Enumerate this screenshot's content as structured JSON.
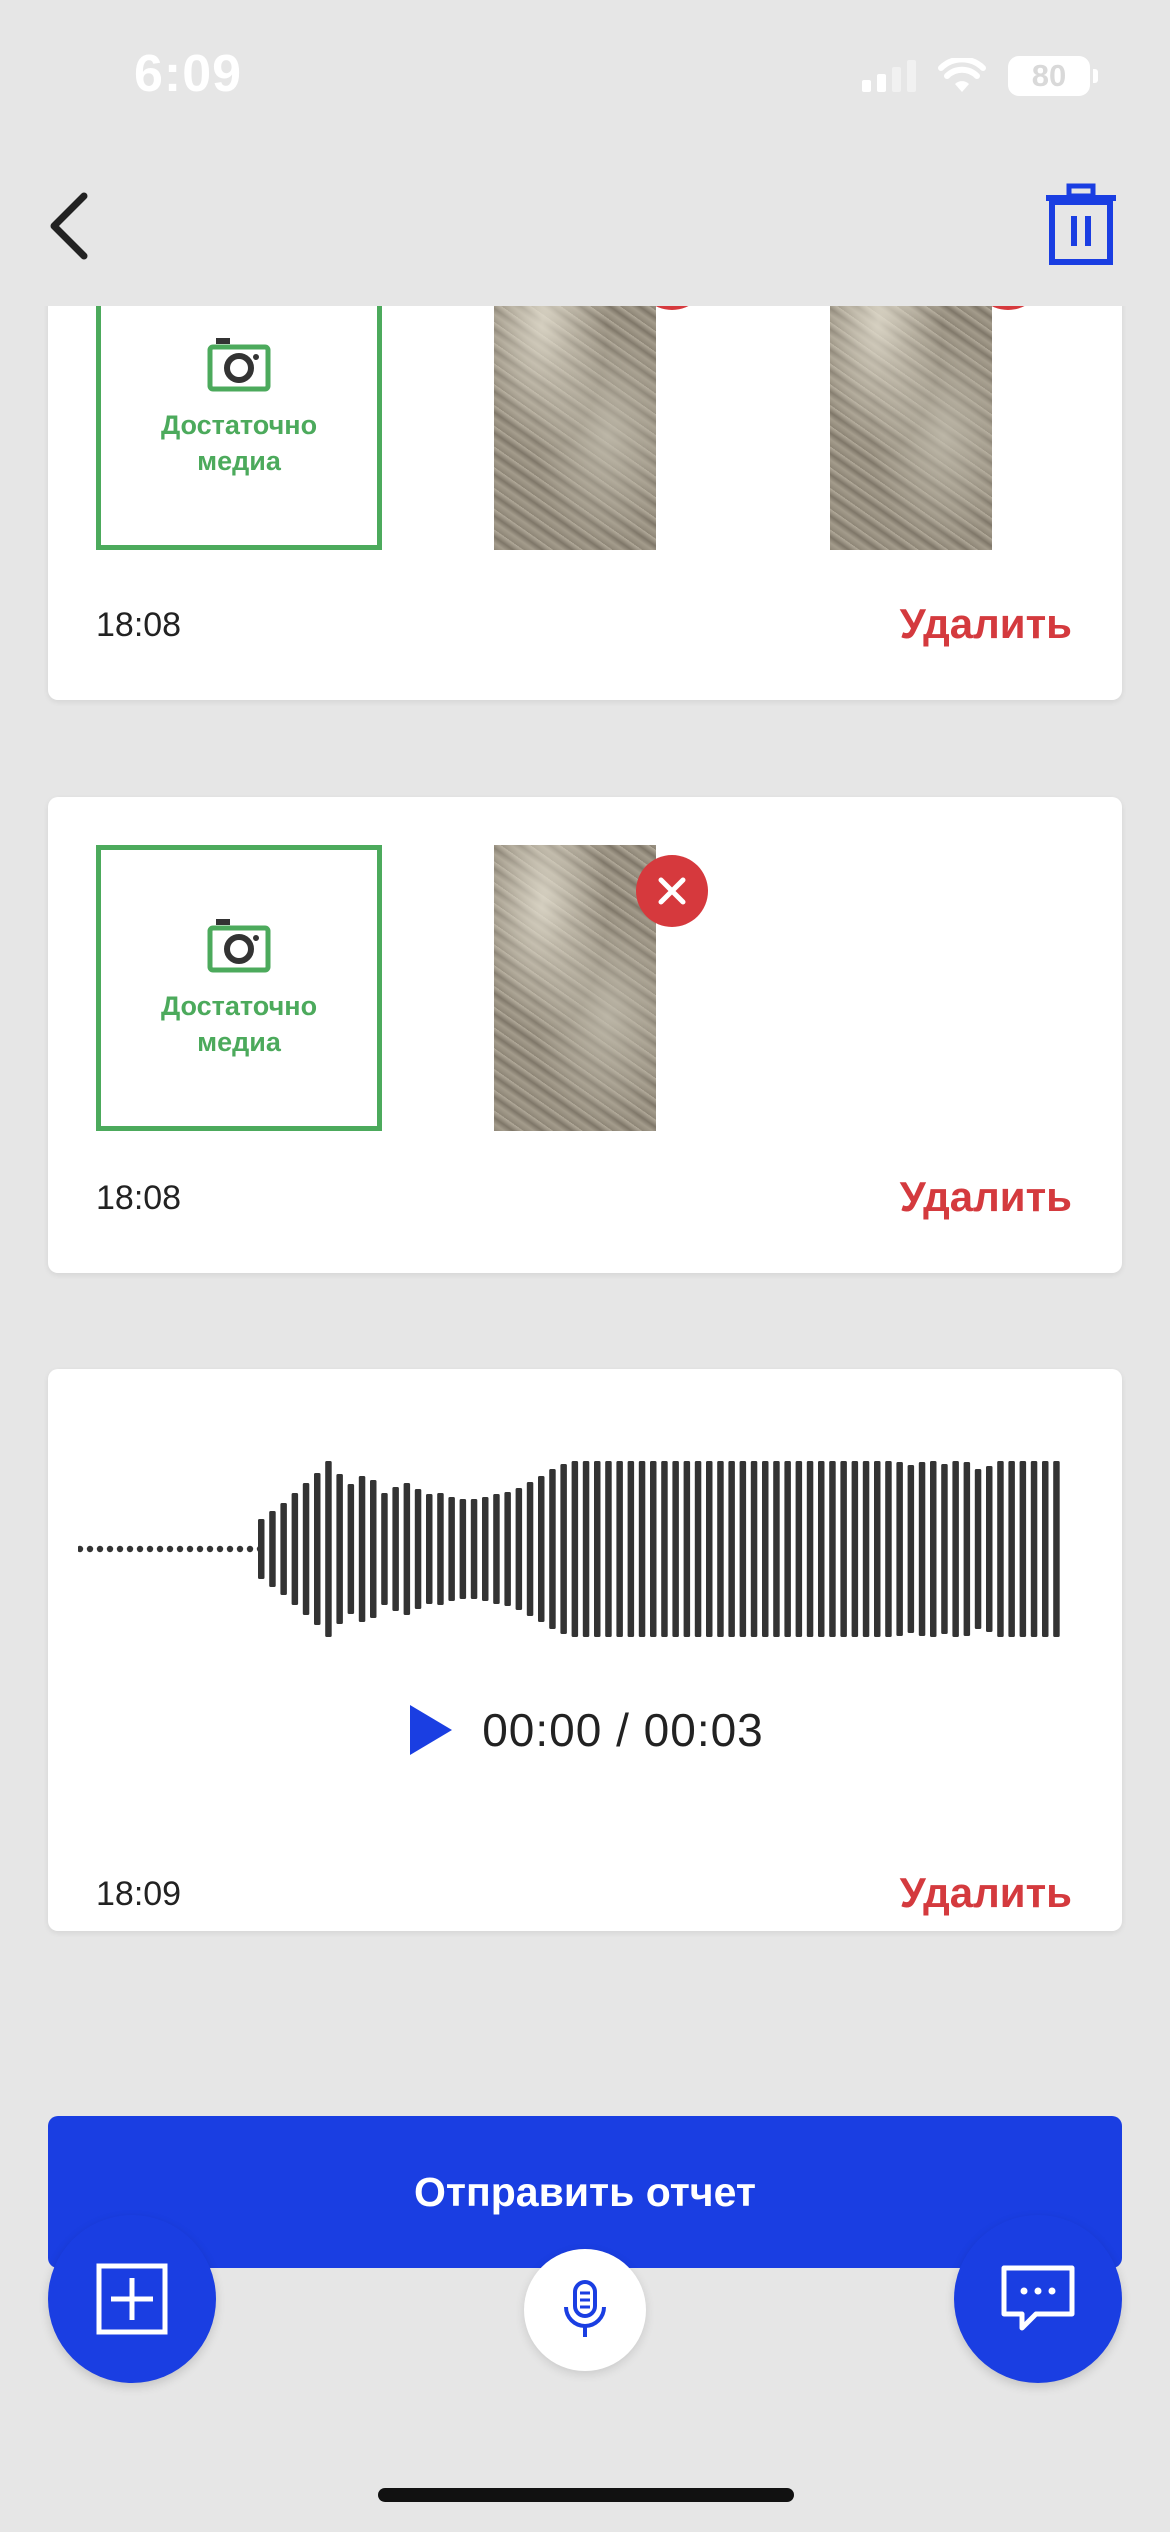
{
  "status_bar": {
    "time": "6:09",
    "battery": "80"
  },
  "icons": {
    "back": "chevron-left-icon",
    "trash": "trash-icon",
    "camera": "camera-icon",
    "remove": "close-icon",
    "play": "play-icon",
    "add": "plus-square-icon",
    "mic": "microphone-icon",
    "chat": "chat-icon"
  },
  "colors": {
    "accent": "#1a3ee2",
    "danger": "#d43a3e",
    "success": "#4caa5c",
    "background": "#e6e6e6"
  },
  "cards": [
    {
      "media_label": "Достаточно медиа",
      "time": "18:08",
      "delete_label": "Удалить",
      "photos": 2
    },
    {
      "media_label": "Достаточно медиа",
      "time": "18:08",
      "delete_label": "Удалить",
      "photos": 1
    }
  ],
  "audio_card": {
    "player_time": "00:00 / 00:03",
    "time": "18:09",
    "delete_label": "Удалить"
  },
  "send_button": {
    "label": "Отправить отчет"
  }
}
